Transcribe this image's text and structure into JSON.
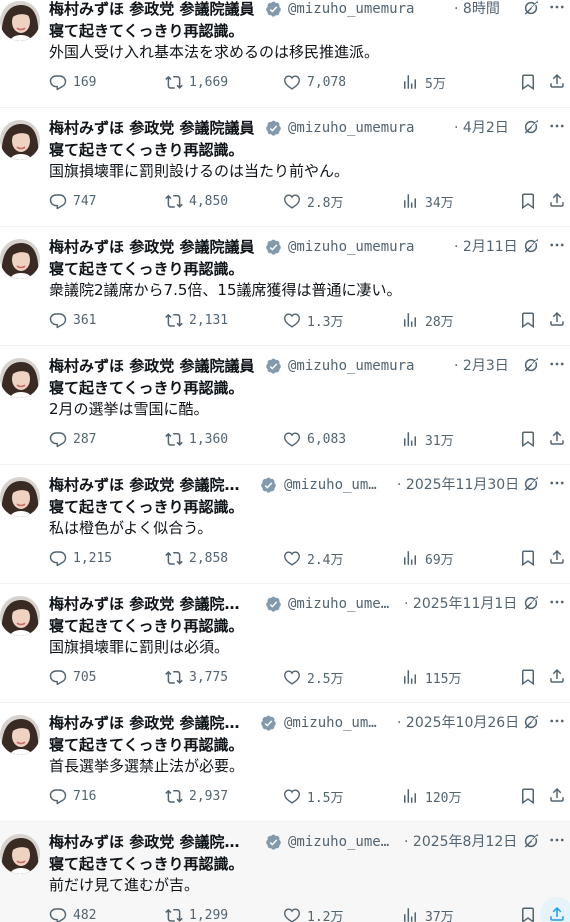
{
  "colors": {
    "text": "#0f1419",
    "muted": "#536471",
    "verified": "#829aab",
    "share_active": "#1d9bf0"
  },
  "icons": {
    "reply": "reply-icon",
    "retweet": "retweet-icon",
    "like": "heart-icon",
    "views": "views-icon",
    "bookmark": "bookmark-icon",
    "share": "share-icon",
    "verified": "verified-badge-icon",
    "grok": "grok-icon",
    "more": "more-icon"
  },
  "tweets": [
    {
      "name": "梅村みずほ 参政党 参議院議員",
      "handle": "@mizuho_umemura",
      "time": "8時間",
      "line1": "寝て起きてくっきり再認識。",
      "line2": "外国人受け入れ基本法を求めるのは移民推進派。",
      "replies": "169",
      "retweets": "1,669",
      "likes": "7,078",
      "views": "5万"
    },
    {
      "name": "梅村みずほ 参政党 参議院議員",
      "handle": "@mizuho_umemura",
      "time": "4月2日",
      "line1": "寝て起きてくっきり再認識。",
      "line2": "国旗損壊罪に罰則設けるのは当たり前やん。",
      "replies": "747",
      "retweets": "4,850",
      "likes": "2.8万",
      "views": "34万"
    },
    {
      "name": "梅村みずほ 参政党 参議院議員",
      "handle": "@mizuho_umemura",
      "time": "2月11日",
      "line1": "寝て起きてくっきり再認識。",
      "line2": "衆議院2議席から7.5倍、15議席獲得は普通に凄い。",
      "replies": "361",
      "retweets": "2,131",
      "likes": "1.3万",
      "views": "28万"
    },
    {
      "name": "梅村みずほ 参政党 参議院議員",
      "handle": "@mizuho_umemura",
      "time": "2月3日",
      "line1": "寝て起きてくっきり再認識。",
      "line2": "2月の選挙は雪国に酷。",
      "replies": "287",
      "retweets": "1,360",
      "likes": "6,083",
      "views": "31万"
    },
    {
      "name": "梅村みずほ 参政党 参議院…",
      "handle": "@mizuho_umem…",
      "time": "2025年11月30日",
      "line1": "寝て起きてくっきり再認識。",
      "line2": "私は橙色がよく似合う。",
      "replies": "1,215",
      "retweets": "2,858",
      "likes": "2.4万",
      "views": "69万"
    },
    {
      "name": "梅村みずほ 参政党 参議院…",
      "handle": "@mizuho_umemu…",
      "time": "2025年11月1日",
      "line1": "寝て起きてくっきり再認識。",
      "line2": "国旗損壊罪に罰則は必須。",
      "replies": "705",
      "retweets": "3,775",
      "likes": "2.5万",
      "views": "115万"
    },
    {
      "name": "梅村みずほ 参政党 参議院…",
      "handle": "@mizuho_umem…",
      "time": "2025年10月26日",
      "line1": "寝て起きてくっきり再認識。",
      "line2": "首長選挙多選禁止法が必要。",
      "replies": "716",
      "retweets": "2,937",
      "likes": "1.5万",
      "views": "120万"
    },
    {
      "name": "梅村みずほ 参政党 参議院…",
      "handle": "@mizuho_umemu…",
      "time": "2025年8月12日",
      "line1": "寝て起きてくっきり再認識。",
      "line2": "前だけ見て進むが吉。",
      "replies": "482",
      "retweets": "1,299",
      "likes": "1.2万",
      "views": "37万"
    }
  ]
}
